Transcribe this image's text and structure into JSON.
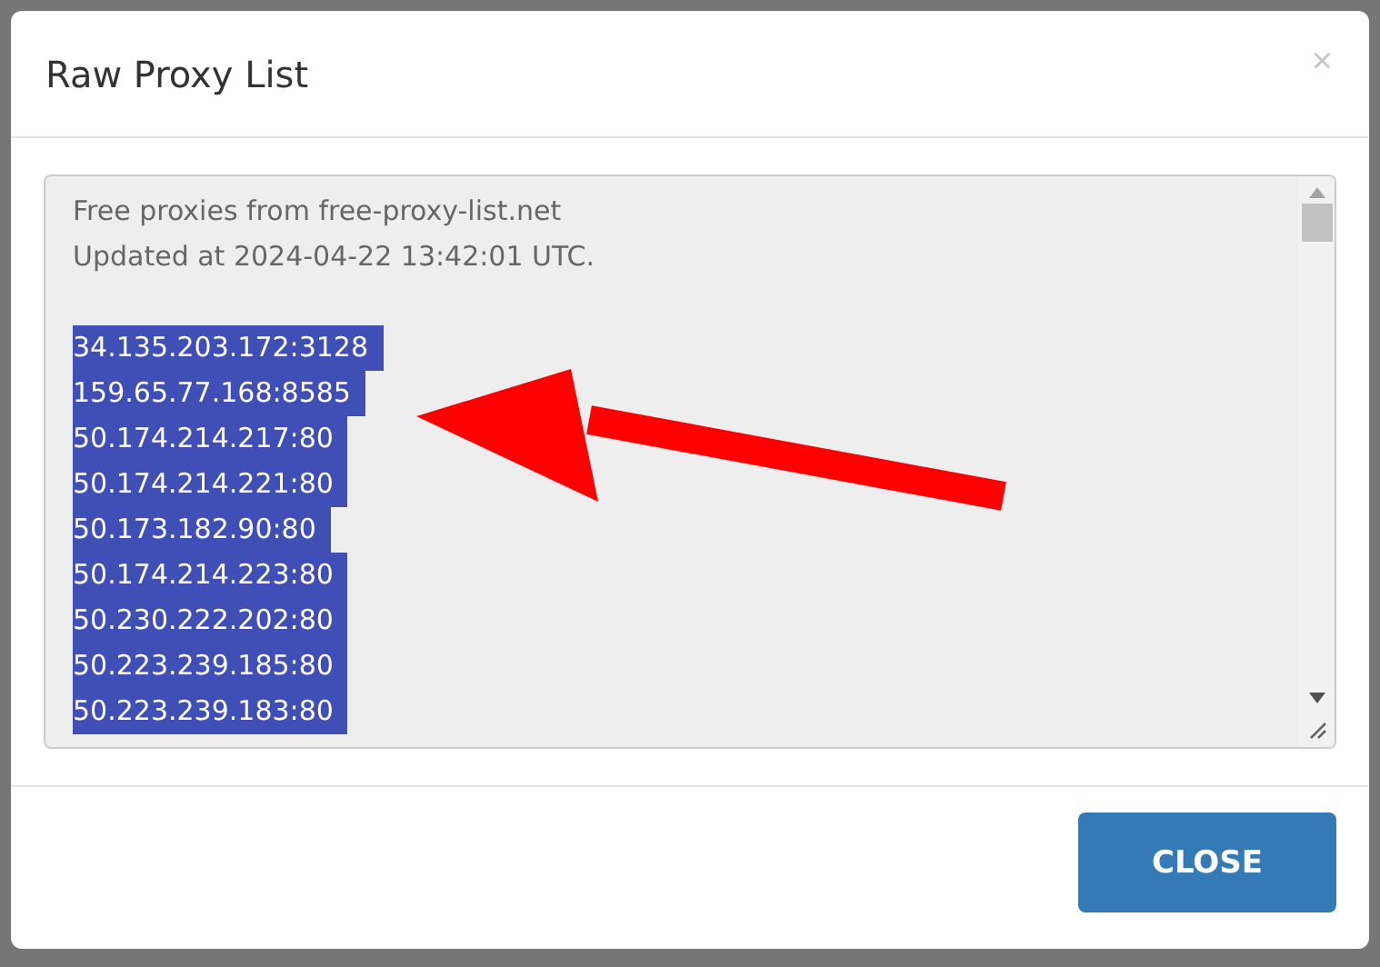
{
  "modal": {
    "title": "Raw Proxy List",
    "close_icon": "×"
  },
  "textarea": {
    "header_lines": [
      "Free proxies from free-proxy-list.net",
      "Updated at 2024-04-22 13:42:01 UTC."
    ],
    "proxies": [
      {
        "text": "34.135.203.172:3128",
        "selected": true
      },
      {
        "text": "159.65.77.168:8585",
        "selected": true
      },
      {
        "text": "50.174.214.217:80",
        "selected": true
      },
      {
        "text": "50.174.214.221:80",
        "selected": true
      },
      {
        "text": "50.173.182.90:80",
        "selected": true
      },
      {
        "text": "50.174.214.223:80",
        "selected": true
      },
      {
        "text": "50.230.222.202:80",
        "selected": true
      },
      {
        "text": "50.223.239.185:80",
        "selected": true
      },
      {
        "text": "50.223.239.183:80",
        "selected": true
      }
    ]
  },
  "footer": {
    "button": "CLOSE"
  }
}
